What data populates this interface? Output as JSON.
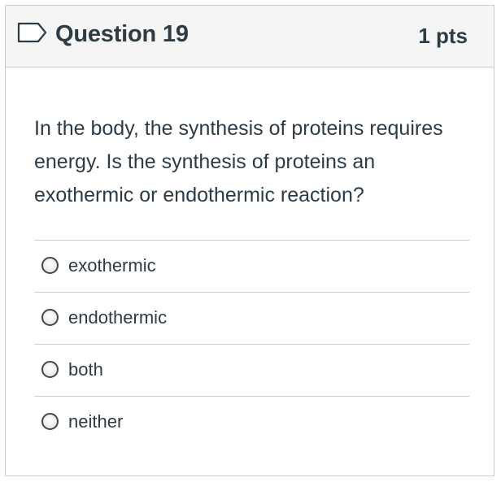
{
  "question": {
    "title": "Question 19",
    "points": "1 pts",
    "text": "In the body, the synthesis of proteins requires energy. Is the synthesis of proteins an exothermic or endothermic reaction?",
    "flag_icon": "flag-outline-icon"
  },
  "answers": [
    {
      "label": "exothermic",
      "selected": false
    },
    {
      "label": "endothermic",
      "selected": false
    },
    {
      "label": "both",
      "selected": false
    },
    {
      "label": "neither",
      "selected": false
    }
  ],
  "colors": {
    "text": "#2d3b45",
    "header_bg": "#f5f5f5",
    "border": "#c7cdd1"
  }
}
